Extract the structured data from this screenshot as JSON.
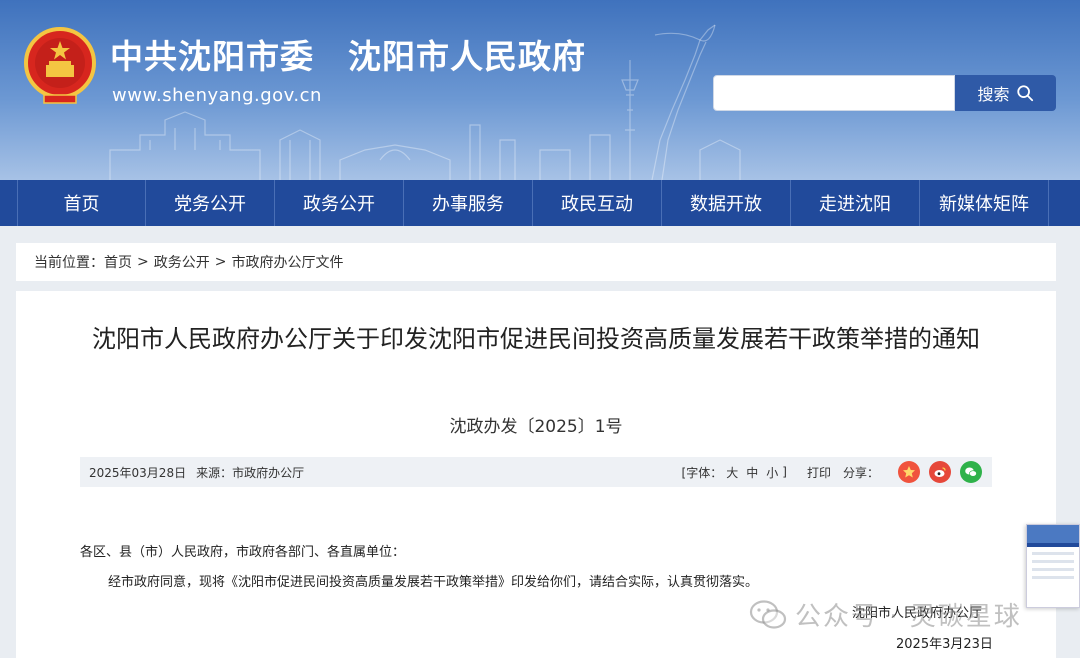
{
  "header": {
    "site_title": "中共沈阳市委　沈阳市人民政府",
    "site_url": "www.shenyang.gov.cn",
    "search_placeholder": "",
    "search_label": "搜索",
    "search_icon": "search-icon",
    "emblem_icon": "national-emblem-icon"
  },
  "nav": {
    "items": [
      {
        "label": "首页"
      },
      {
        "label": "党务公开"
      },
      {
        "label": "政务公开"
      },
      {
        "label": "办事服务"
      },
      {
        "label": "政民互动"
      },
      {
        "label": "数据开放"
      },
      {
        "label": "走进沈阳"
      },
      {
        "label": "新媒体矩阵"
      }
    ]
  },
  "breadcrumb": {
    "prefix": "当前位置：",
    "items": [
      {
        "label": "首页"
      },
      {
        "label": "政务公开"
      },
      {
        "label": "市政府办公厅文件"
      }
    ],
    "separator": ">"
  },
  "article": {
    "title": "沈阳市人民政府办公厅关于印发沈阳市促进民间投资高质量发展若干政策举措的通知",
    "doc_number": "沈政办发〔2025〕1号",
    "date": "2025年03月28日",
    "source_label": "来源：市政府办公厅",
    "font_size_label_open": "[字体：",
    "font_sizes": [
      "大",
      "中",
      "小"
    ],
    "font_size_label_close": "]",
    "print_label": "打印",
    "share_label": "分享：",
    "share_icons": [
      {
        "name": "qzone-share-icon",
        "color": "#f0533d"
      },
      {
        "name": "weibo-share-icon",
        "color": "#e6483a"
      },
      {
        "name": "wechat-share-icon",
        "color": "#2fb24a"
      }
    ],
    "salutation": "各区、县（市）人民政府，市政府各部门、各直属单位：",
    "body": "经市政府同意，现将《沈阳市促进民间投资高质量发展若干政策举措》印发给你们，请结合实际，认真贯彻落实。",
    "signature": "沈阳市人民政府办公厅",
    "sign_date": "2025年3月23日"
  },
  "watermark": {
    "text": "公众号 · 灵碳星球",
    "icon": "wechat-official-account-icon"
  },
  "colors": {
    "nav_bg": "#214a9b",
    "header_top": "#3f72bd",
    "search_button": "#2f5aa7"
  }
}
